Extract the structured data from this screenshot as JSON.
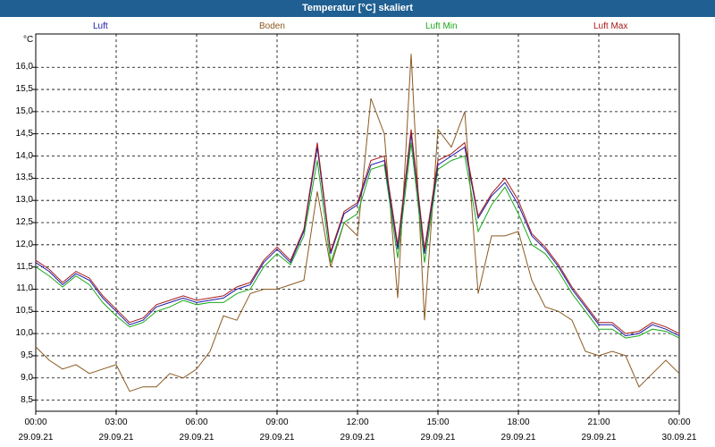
{
  "window": {
    "title": "Temperatur [°C] skaliert"
  },
  "legend": [
    {
      "label": "Luft",
      "color": "#1a1aa8"
    },
    {
      "label": "Boden",
      "color": "#8b5a20"
    },
    {
      "label": "Luft Min",
      "color": "#1aa81a"
    },
    {
      "label": "Luft Max",
      "color": "#a81a1a"
    }
  ],
  "chart_data": {
    "type": "line",
    "ylabel": "°C",
    "ylim": [
      8.25,
      16.75
    ],
    "xlim": [
      0,
      24
    ],
    "grid": true,
    "y_ticks": [
      "16,0",
      "15,5",
      "15,0",
      "14,5",
      "14,0",
      "13,5",
      "13,0",
      "12,5",
      "12,0",
      "11,5",
      "11,0",
      "10,5",
      "10,0",
      "9,5",
      "9,0",
      "8,5"
    ],
    "x_ticks": [
      {
        "time": "00:00",
        "date": "29.09.21"
      },
      {
        "time": "03:00",
        "date": "29.09.21"
      },
      {
        "time": "06:00",
        "date": "29.09.21"
      },
      {
        "time": "09:00",
        "date": "29.09.21"
      },
      {
        "time": "12:00",
        "date": "29.09.21"
      },
      {
        "time": "15:00",
        "date": "29.09.21"
      },
      {
        "time": "18:00",
        "date": "29.09.21"
      },
      {
        "time": "21:00",
        "date": "29.09.21"
      },
      {
        "time": "00:00",
        "date": "30.09.21"
      }
    ],
    "x_hours": [
      0,
      0.5,
      1,
      1.5,
      2,
      2.5,
      3,
      3.5,
      4,
      4.5,
      5,
      5.5,
      6,
      6.5,
      7,
      7.5,
      8,
      8.5,
      9,
      9.5,
      10,
      10.5,
      11,
      11.5,
      12,
      12.5,
      13,
      13.5,
      14,
      14.5,
      15,
      15.5,
      16,
      16.5,
      17,
      17.5,
      18,
      18.5,
      19,
      19.5,
      20,
      20.5,
      21,
      21.5,
      22,
      22.5,
      23,
      23.5,
      24
    ],
    "series": [
      {
        "name": "Luft",
        "color": "#1a1aa8",
        "values": [
          11.6,
          11.4,
          11.1,
          11.35,
          11.2,
          10.8,
          10.5,
          10.2,
          10.3,
          10.6,
          10.7,
          10.8,
          10.7,
          10.75,
          10.8,
          11.0,
          11.1,
          11.6,
          11.9,
          11.6,
          12.3,
          14.2,
          11.8,
          12.7,
          12.9,
          13.8,
          13.9,
          11.9,
          14.5,
          11.8,
          13.8,
          14.0,
          14.2,
          12.6,
          13.1,
          13.4,
          12.9,
          12.2,
          11.9,
          11.5,
          11.0,
          10.6,
          10.2,
          10.2,
          9.95,
          10.0,
          10.2,
          10.1,
          9.95
        ]
      },
      {
        "name": "Boden",
        "color": "#8b5a20",
        "values": [
          9.7,
          9.4,
          9.2,
          9.3,
          9.1,
          9.2,
          9.3,
          8.7,
          8.8,
          8.8,
          9.1,
          9.0,
          9.2,
          9.6,
          10.4,
          10.3,
          10.9,
          11.0,
          11.0,
          11.1,
          11.2,
          13.2,
          11.5,
          12.5,
          12.2,
          15.3,
          14.5,
          10.8,
          16.3,
          10.3,
          14.6,
          14.2,
          15.0,
          10.9,
          12.2,
          12.2,
          12.3,
          11.2,
          10.6,
          10.5,
          10.3,
          9.6,
          9.5,
          9.6,
          9.5,
          8.8,
          9.1,
          9.4,
          9.1
        ]
      },
      {
        "name": "Luft Min",
        "color": "#1aa81a",
        "values": [
          11.5,
          11.3,
          11.05,
          11.3,
          11.1,
          10.7,
          10.4,
          10.15,
          10.25,
          10.5,
          10.6,
          10.75,
          10.65,
          10.7,
          10.7,
          10.9,
          11.0,
          11.5,
          11.8,
          11.55,
          12.2,
          13.9,
          11.6,
          12.5,
          12.7,
          13.7,
          13.8,
          11.7,
          14.3,
          11.6,
          13.7,
          13.9,
          14.0,
          12.3,
          12.9,
          13.3,
          12.7,
          12.0,
          11.8,
          11.4,
          10.9,
          10.5,
          10.1,
          10.1,
          9.9,
          9.95,
          10.1,
          10.05,
          9.9
        ]
      },
      {
        "name": "Luft Max",
        "color": "#a81a1a",
        "values": [
          11.65,
          11.45,
          11.15,
          11.4,
          11.25,
          10.85,
          10.55,
          10.25,
          10.35,
          10.65,
          10.75,
          10.85,
          10.75,
          10.8,
          10.85,
          11.05,
          11.15,
          11.65,
          11.95,
          11.65,
          12.35,
          14.3,
          11.85,
          12.75,
          12.95,
          13.9,
          14.0,
          12.0,
          14.6,
          11.9,
          13.9,
          14.05,
          14.3,
          12.65,
          13.15,
          13.5,
          13.0,
          12.25,
          11.95,
          11.55,
          11.05,
          10.65,
          10.25,
          10.25,
          10.0,
          10.05,
          10.25,
          10.15,
          10.0
        ]
      }
    ]
  }
}
